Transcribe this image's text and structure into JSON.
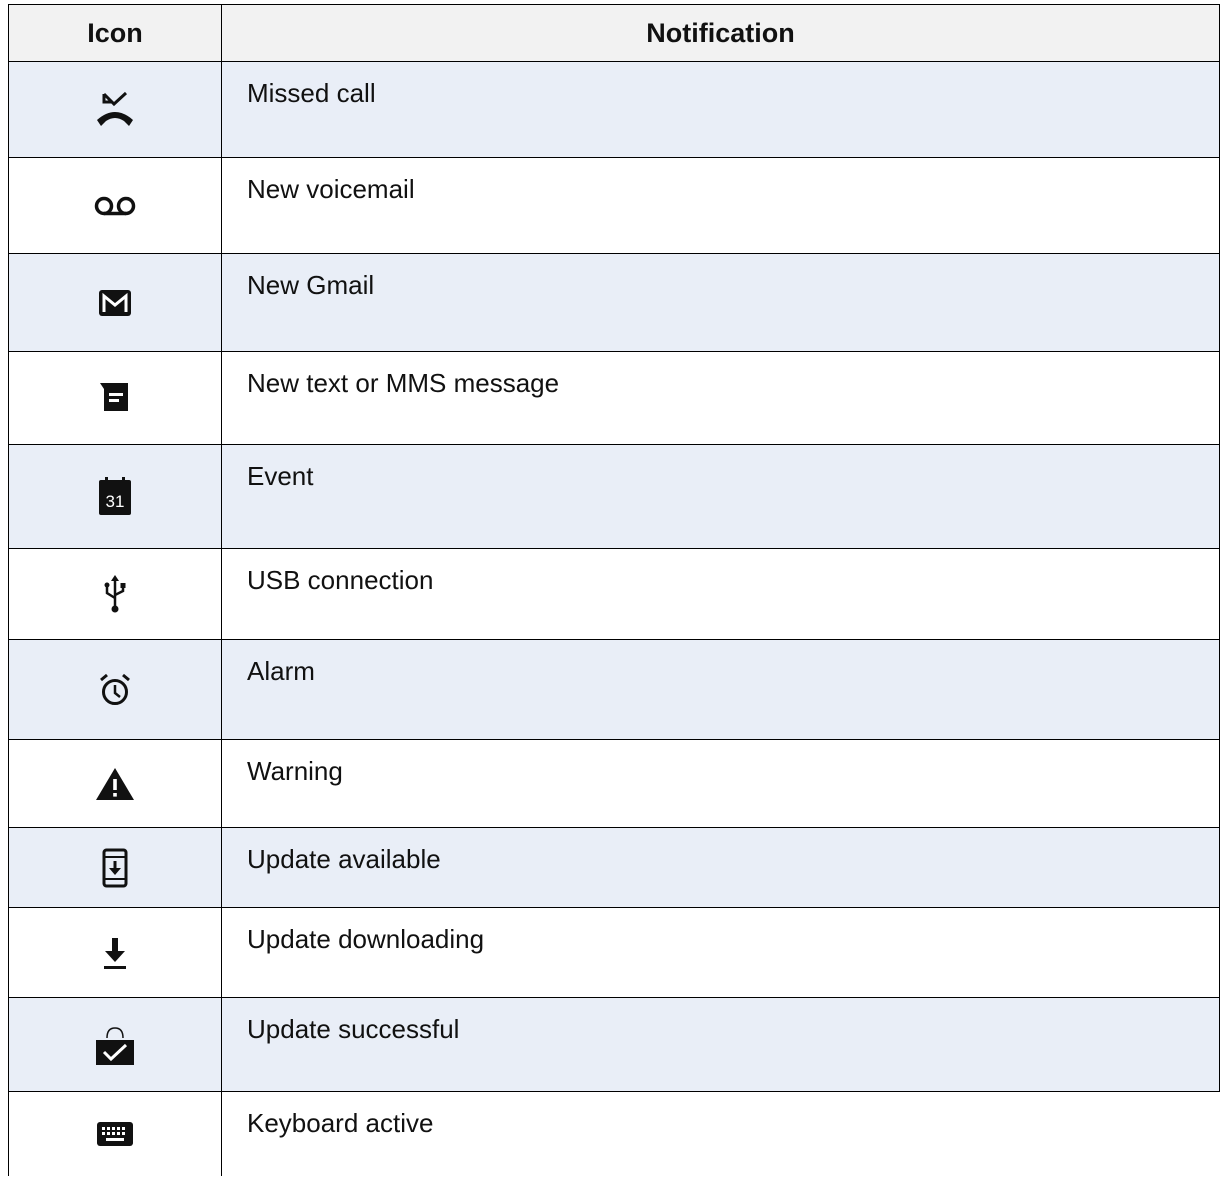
{
  "header": {
    "icon_col": "Icon",
    "notification_col": "Notification"
  },
  "rows": [
    {
      "icon": "missed-call-icon",
      "label": "Missed call"
    },
    {
      "icon": "voicemail-icon",
      "label": "New voicemail"
    },
    {
      "icon": "gmail-icon",
      "label": "New Gmail"
    },
    {
      "icon": "message-icon",
      "label": "New text or MMS message"
    },
    {
      "icon": "calendar-event-icon",
      "label": "Event",
      "icon_text": "31"
    },
    {
      "icon": "usb-icon",
      "label": "USB connection"
    },
    {
      "icon": "alarm-icon",
      "label": "Alarm"
    },
    {
      "icon": "warning-icon",
      "label": "Warning"
    },
    {
      "icon": "system-update-icon",
      "label": "Update available"
    },
    {
      "icon": "download-icon",
      "label": "Update downloading"
    },
    {
      "icon": "update-success-icon",
      "label": "Update successful"
    },
    {
      "icon": "keyboard-icon",
      "label": "Keyboard active"
    }
  ],
  "colors": {
    "shaded_row": "#e9eef7",
    "header_bg": "#f2f2f2",
    "border": "#000000"
  }
}
